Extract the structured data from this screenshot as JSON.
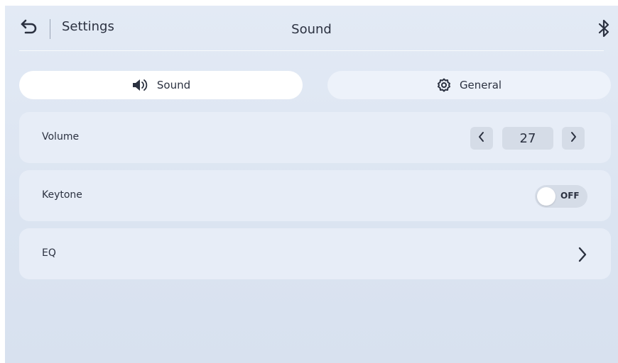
{
  "header": {
    "back_icon": "undo-arrow-icon",
    "settings_label": "Settings",
    "title": "Sound",
    "bluetooth_icon": "bluetooth-icon"
  },
  "tabs": [
    {
      "label": "Sound",
      "icon": "speaker-icon",
      "selected": true
    },
    {
      "label": "General",
      "icon": "gear-icon",
      "selected": false
    }
  ],
  "settings": {
    "volume": {
      "label": "Volume",
      "value": "27"
    },
    "keytone": {
      "label": "Keytone",
      "state": "OFF"
    },
    "eq": {
      "label": "EQ"
    }
  },
  "colors": {
    "background": "#dde6f3",
    "card": "#e7edf7",
    "selected_tab": "#ffffff",
    "control": "#d5dce7",
    "text": "#2b3140"
  }
}
